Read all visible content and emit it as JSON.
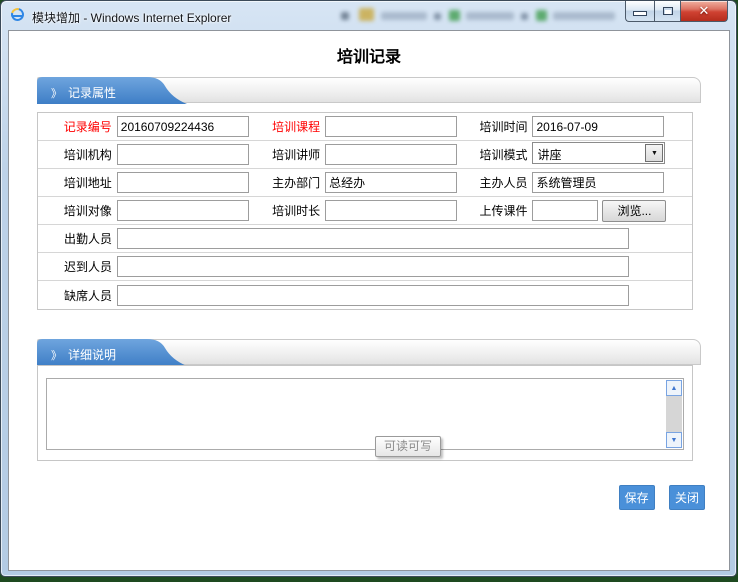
{
  "window": {
    "title": "模块增加 - Windows Internet Explorer",
    "close_glyph": "✕"
  },
  "page": {
    "title": "培训记录"
  },
  "sections": [
    {
      "marker": "》",
      "label": "记录属性"
    },
    {
      "marker": "》",
      "label": "详细说明"
    }
  ],
  "fields": {
    "record_no": {
      "label": "记录编号",
      "value": "20160709224436"
    },
    "course": {
      "label": "培训课程",
      "value": ""
    },
    "train_time": {
      "label": "培训时间",
      "value": "2016-07-09"
    },
    "org": {
      "label": "培训机构",
      "value": ""
    },
    "lecturer": {
      "label": "培训讲师",
      "value": ""
    },
    "mode": {
      "label": "培训模式",
      "value": "讲座",
      "arrow_glyph": "▼"
    },
    "address": {
      "label": "培训地址",
      "value": ""
    },
    "dept": {
      "label": "主办部门",
      "value": "总经办"
    },
    "host": {
      "label": "主办人员",
      "value": "系统管理员"
    },
    "target": {
      "label": "培训对像",
      "value": ""
    },
    "duration": {
      "label": "培训时长",
      "value": ""
    },
    "upload": {
      "label": "上传课件",
      "value": "",
      "browse_label": "浏览..."
    },
    "attendees": {
      "label": "出勤人员",
      "value": ""
    },
    "late": {
      "label": "迟到人员",
      "value": ""
    },
    "absent": {
      "label": "缺席人员",
      "value": ""
    }
  },
  "editor": {
    "hint": "可读可写",
    "scroll_up_glyph": "▲",
    "scroll_down_glyph": "▼"
  },
  "actions": {
    "save": "保存",
    "close": "关闭"
  },
  "colors": {
    "tab_blue_top": "#6fa5de",
    "tab_blue_bottom": "#3e7ec6",
    "required_red": "#ff0000",
    "action_blue": "#4a90d9",
    "desktop_green": "#1e4a20"
  }
}
